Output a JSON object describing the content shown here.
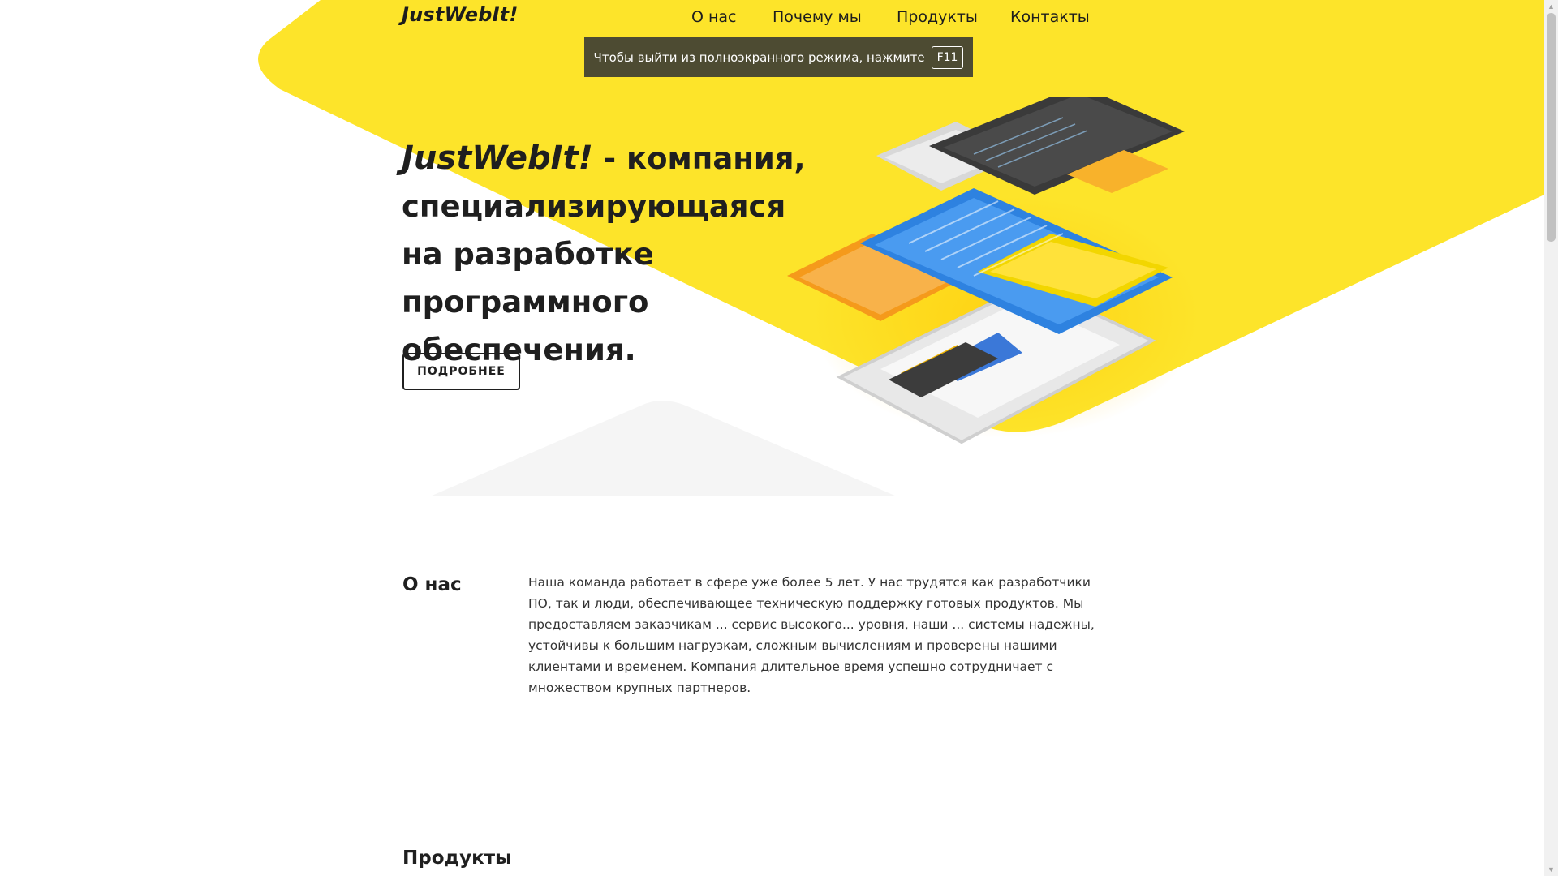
{
  "header": {
    "logo": "JustWebIt!",
    "nav": [
      {
        "label": "О нас"
      },
      {
        "label": "Почему мы"
      },
      {
        "label": "Продукты"
      },
      {
        "label": "Контакты"
      }
    ]
  },
  "fullscreen_notice": {
    "text": "Чтобы выйти из полноэкранного режима, нажмите",
    "key": "F11"
  },
  "hero": {
    "brand": "JustWebIt!",
    "title_rest": " - компания, специализирующаяся на разработке программного обеспечения.",
    "button_label": "ПОДРОБНЕЕ"
  },
  "about": {
    "title": "О нас",
    "text": "Наша команда работает в сфере уже более 5 лет. У нас трудятся как разработчики ПО, так и люди, обеспечивающее техническую поддержку готовых продуктов. Мы предоставляем заказчикам ... сервис высокого... уровня, наши ... системы надежны, устойчивы к большим нагрузкам, сложным вычислениям и проверены нашими клиентами и временем. Компания длительное время успешно сотрудничает с множеством крупных партнеров."
  },
  "products": {
    "title": "Продукты"
  },
  "colors": {
    "accent": "#fde42a",
    "notice_bg": "#4d4b32",
    "text": "#1f1f1f"
  }
}
